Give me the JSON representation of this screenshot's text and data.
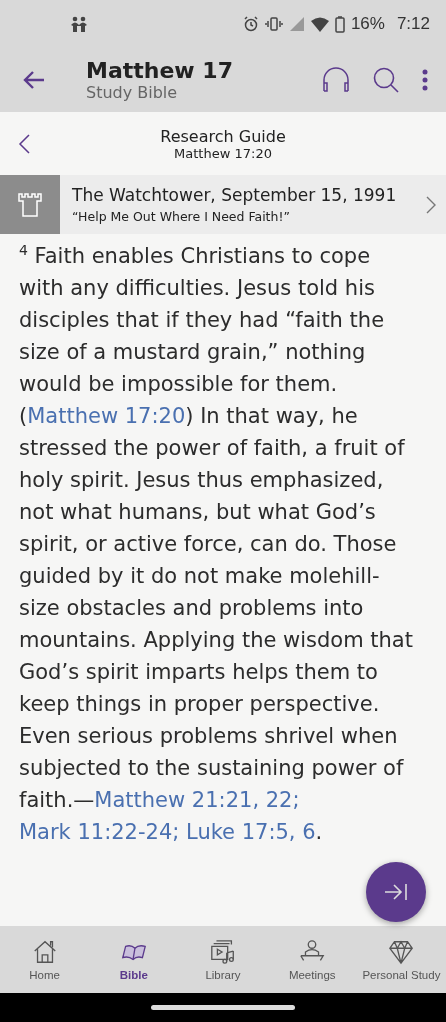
{
  "status_bar": {
    "battery": "16%",
    "time": "7:12"
  },
  "app_bar": {
    "title": "Matthew 17",
    "subtitle": "Study Bible"
  },
  "research_guide": {
    "title": "Research Guide",
    "reference": "Matthew 17:20"
  },
  "publication": {
    "title": "The Watchtower, September 15, 1991",
    "subtitle": "“Help Me Out Where I Need Faith!”"
  },
  "paragraph": [
    {
      "kind": "number",
      "text": "4"
    },
    {
      "kind": "text",
      "text": " Faith enables Christians to cope with any difficulties. Jesus told his disciples that if they had “faith the size of a mustard grain,” nothing would be impossible for them. ("
    },
    {
      "kind": "link",
      "text": "Matthew 17:20"
    },
    {
      "kind": "text",
      "text": ") In that way, he stressed the power of faith, a fruit of holy spirit. Jesus thus emphasized, not what humans, but what God’s spirit, or active force, can do. Those guided by it do not make molehill-size obstacles and problems into mountains. Applying the wisdom that God’s spirit imparts helps them to keep things in proper perspective. Even serious problems shrivel when subjected to the sustaining power of faith.—"
    },
    {
      "kind": "link",
      "text": "Matthew 21:21, 22;"
    },
    {
      "kind": "link",
      "text": "Mark 11:22-24;"
    },
    {
      "kind": "link",
      "text": "Luke 17:5, 6"
    },
    {
      "kind": "text",
      "text": "."
    }
  ],
  "bottom_nav": [
    {
      "label": "Home",
      "kind": "home",
      "selected": false
    },
    {
      "label": "Bible",
      "kind": "book",
      "selected": true
    },
    {
      "label": "Library",
      "kind": "media",
      "selected": false
    },
    {
      "label": "Meetings",
      "kind": "lectern",
      "selected": false
    },
    {
      "label": "Personal Study",
      "kind": "gem",
      "selected": false
    }
  ]
}
